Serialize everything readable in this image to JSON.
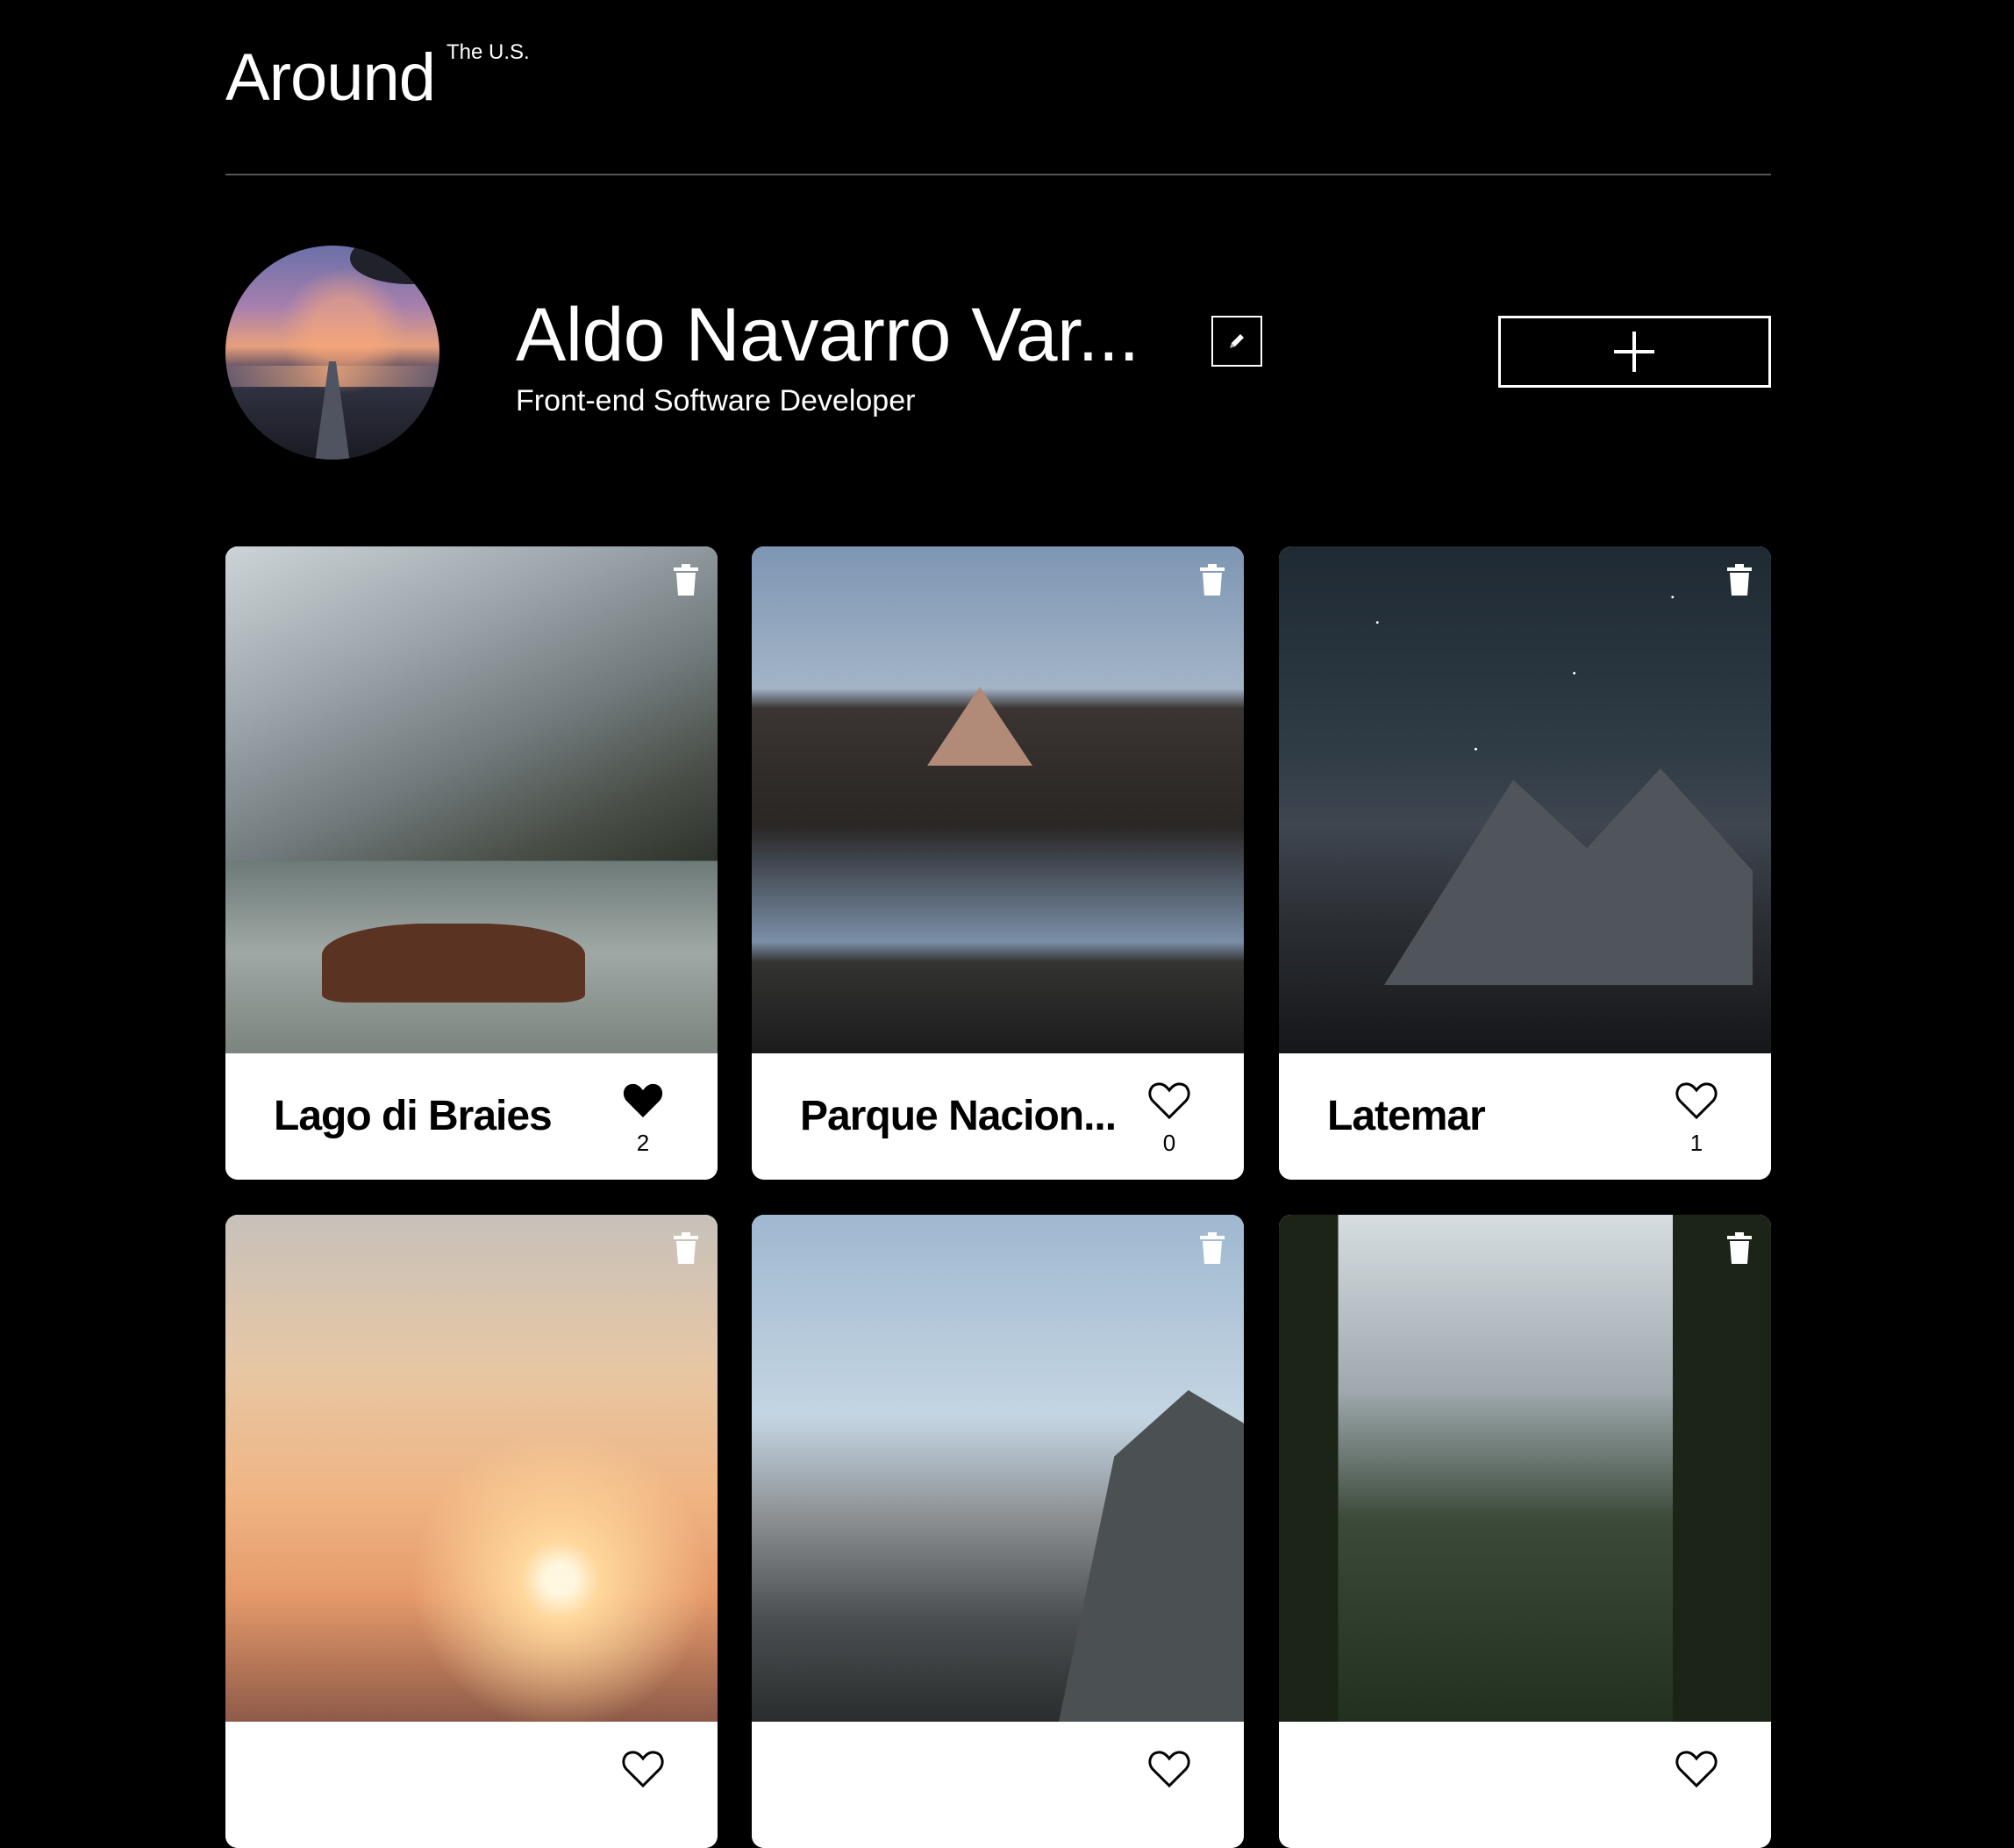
{
  "header": {
    "logo_main": "Around",
    "logo_sup": "The U.S."
  },
  "profile": {
    "name": "Aldo Navarro Var...",
    "about": "Front-end Software Developer"
  },
  "icons": {
    "edit": "pencil-icon",
    "add": "plus-icon",
    "delete": "trash-icon",
    "like": "heart-icon"
  },
  "cards": [
    {
      "title": "Lago di Braies",
      "likes": "2",
      "liked": true
    },
    {
      "title": "Parque Nacion...",
      "likes": "0",
      "liked": false
    },
    {
      "title": "Latemar",
      "likes": "1",
      "liked": false
    },
    {
      "title": "",
      "likes": "",
      "liked": false
    },
    {
      "title": "",
      "likes": "",
      "liked": false
    },
    {
      "title": "",
      "likes": "",
      "liked": false
    }
  ],
  "colors": {
    "background": "#000000",
    "card": "#ffffff",
    "divider": "#545454"
  }
}
